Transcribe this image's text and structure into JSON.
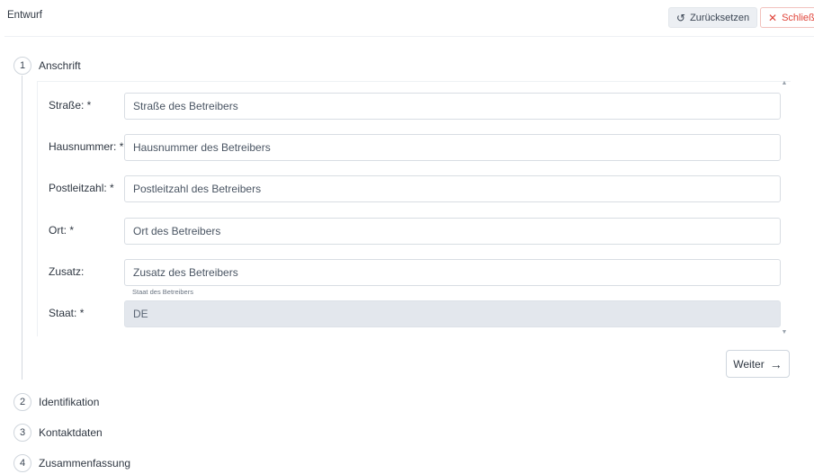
{
  "header": {
    "title": "Entwurf",
    "reset_label": "Zurücksetzen",
    "close_label": "Schließen"
  },
  "steps": [
    {
      "number": "1",
      "label": "Anschrift"
    },
    {
      "number": "2",
      "label": "Identifikation"
    },
    {
      "number": "3",
      "label": "Kontaktdaten"
    },
    {
      "number": "4",
      "label": "Zusammenfassung"
    }
  ],
  "form": {
    "strasse": {
      "label": "Straße: *",
      "placeholder": "Straße des Betreibers"
    },
    "hausnummer": {
      "label": "Hausnummer: *",
      "placeholder": "Hausnummer des Betreibers"
    },
    "plz": {
      "label": "Postleitzahl: *",
      "placeholder": "Postleitzahl des Betreibers"
    },
    "ort": {
      "label": "Ort: *",
      "placeholder": "Ort des Betreibers"
    },
    "zusatz": {
      "label": "Zusatz:",
      "placeholder": "Zusatz des Betreibers"
    },
    "staat": {
      "label": "Staat: *",
      "hint": "Staat des Betreibers",
      "value": "DE"
    }
  },
  "next_label": "Weiter"
}
